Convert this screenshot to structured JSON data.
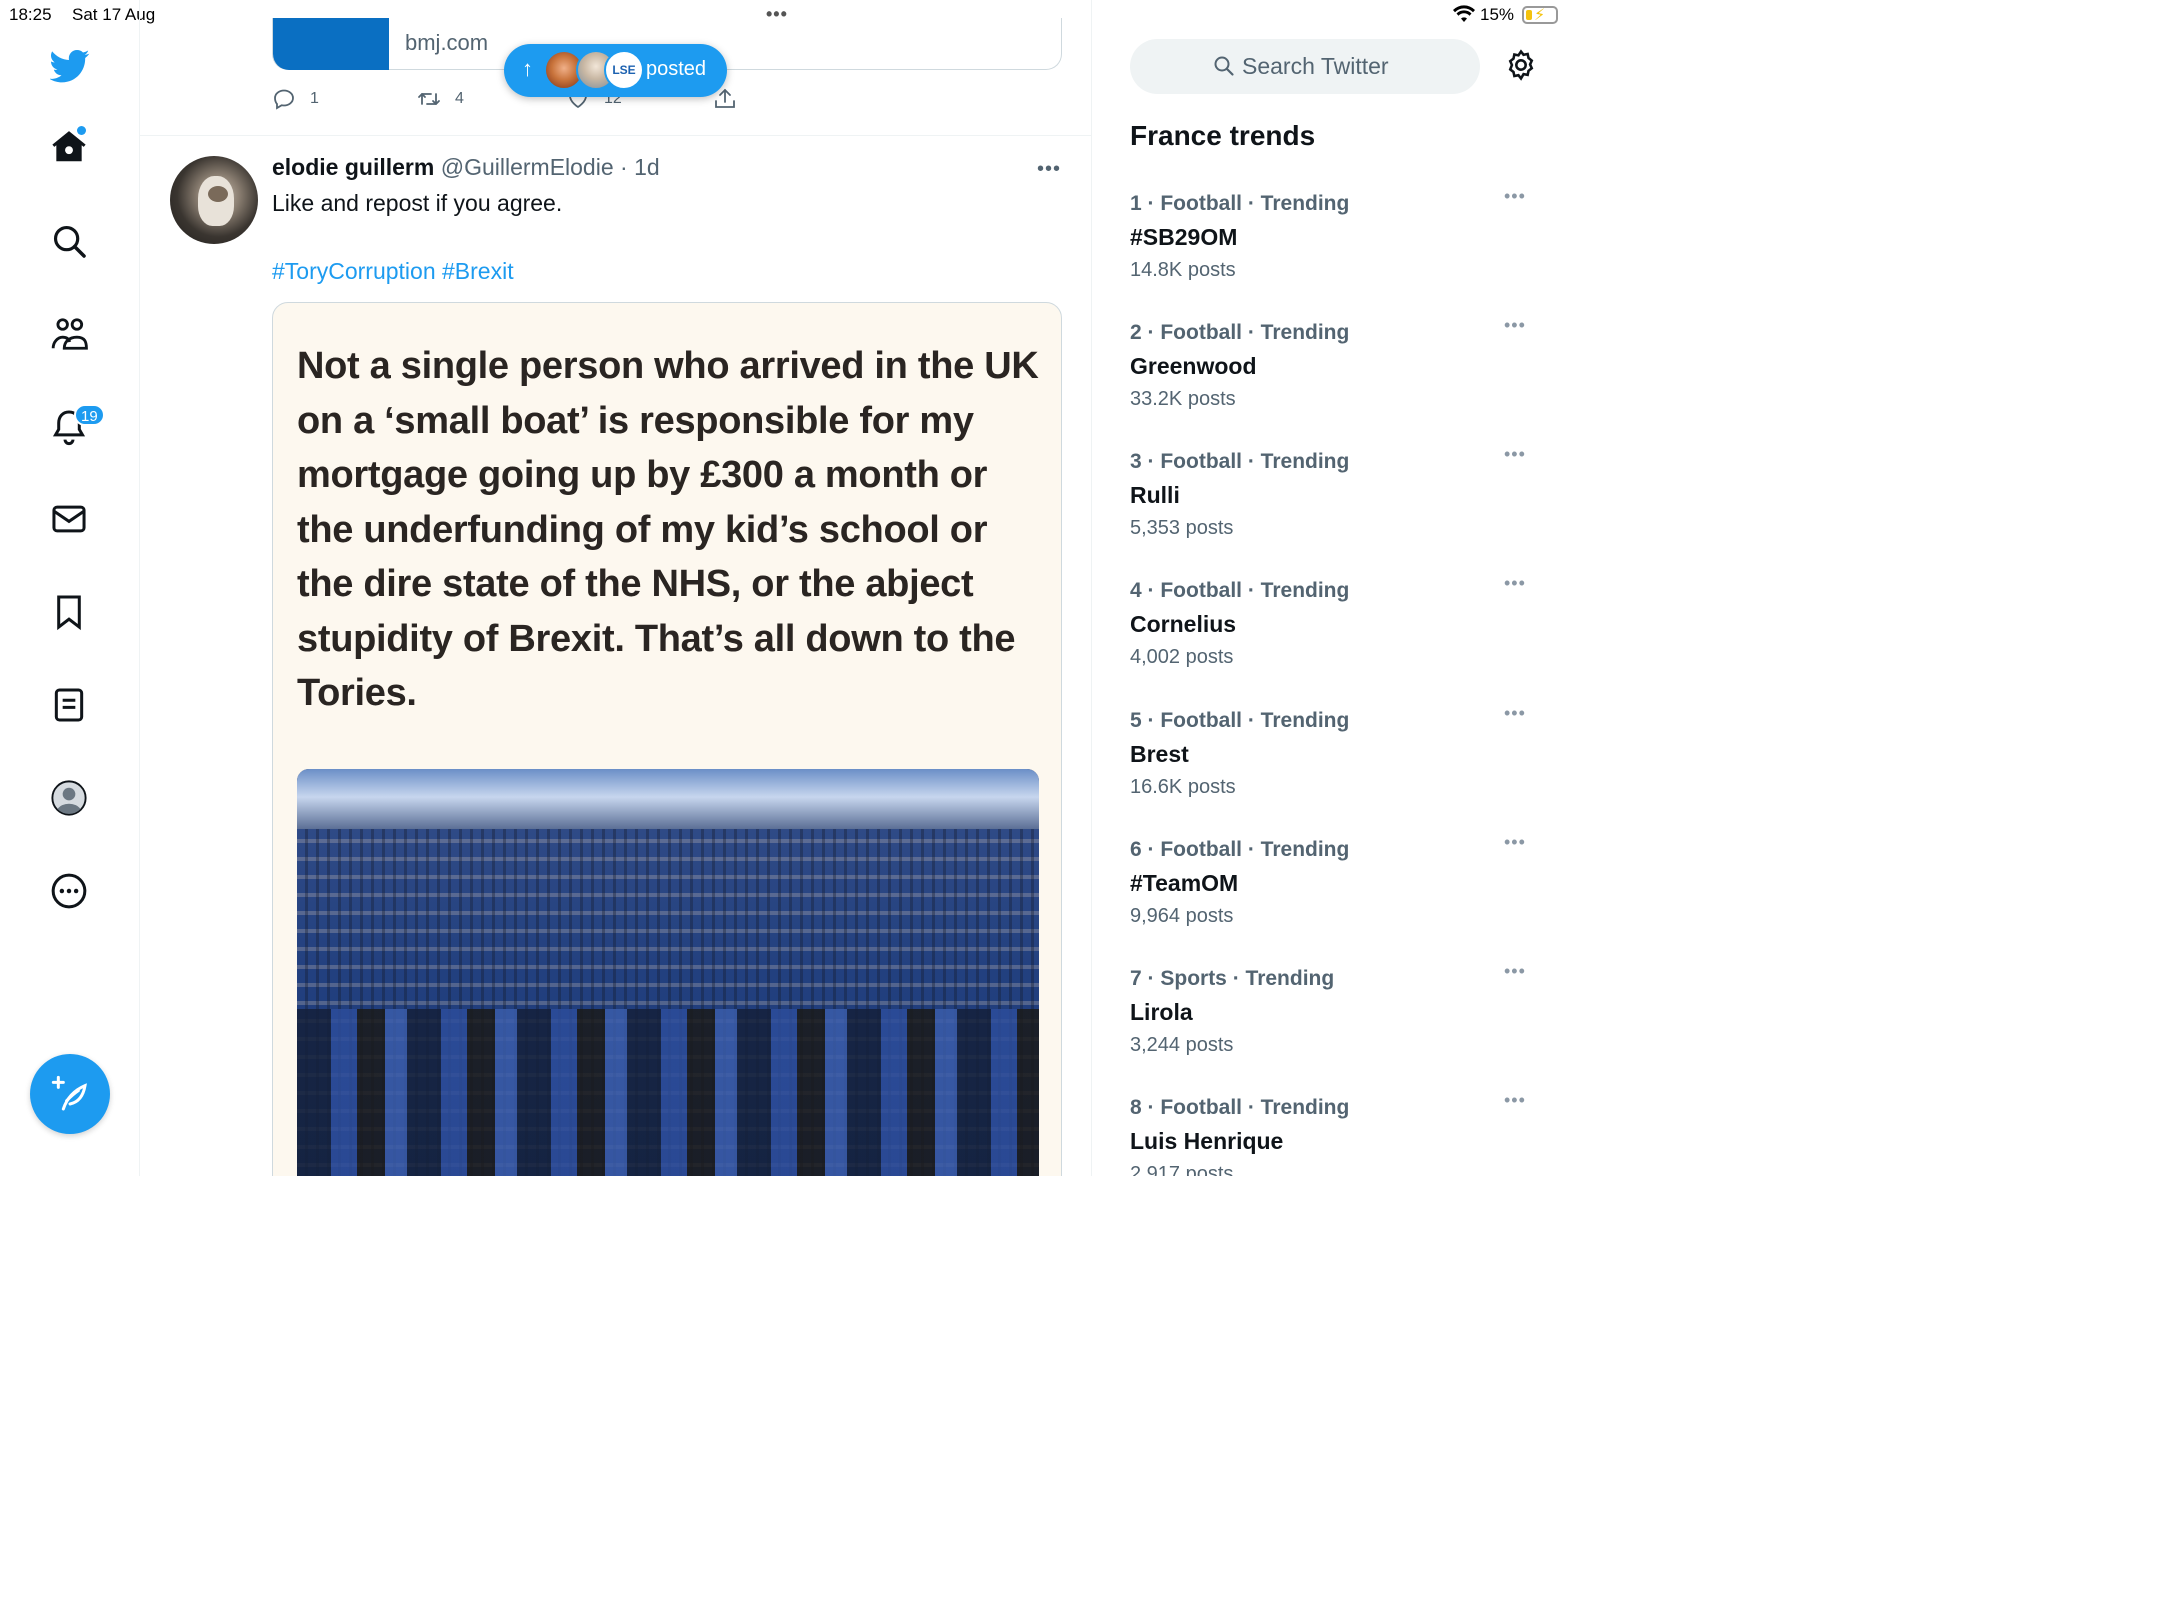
{
  "status_bar": {
    "time": "18:25",
    "date": "Sat 17 Aug",
    "battery": "15%"
  },
  "nav": {
    "notifications_badge": "19"
  },
  "previous_tweet": {
    "domain": "bmj.com",
    "replies": "1",
    "retweets": "4",
    "likes": "12"
  },
  "new_posts_pill": {
    "label": "posted"
  },
  "tweet": {
    "name": "elodie guillerm",
    "handle": "@GuillermElodie",
    "time": "· 1d",
    "text": "Like and repost if you agree.",
    "hashtags": "#ToryCorruption #Brexit",
    "image_quote": "Not a single person who arrived in the UK on a ‘small boat’ is responsible for my mortgage going up by £300 a month or the underfunding of my kid’s school or the dire state of the NHS, or the abject stupidity of Brexit. That’s all down to the Tories."
  },
  "sidebar": {
    "search_placeholder": "Search Twitter",
    "trends_title": "France trends",
    "trends": [
      {
        "rank": "1",
        "category": "Football · Trending",
        "name": "#SB29OM",
        "posts": "14.8K posts"
      },
      {
        "rank": "2",
        "category": "Football · Trending",
        "name": "Greenwood",
        "posts": "33.2K posts"
      },
      {
        "rank": "3",
        "category": "Football · Trending",
        "name": "Rulli",
        "posts": "5,353 posts"
      },
      {
        "rank": "4",
        "category": "Football · Trending",
        "name": "Cornelius",
        "posts": "4,002 posts"
      },
      {
        "rank": "5",
        "category": "Football · Trending",
        "name": "Brest",
        "posts": "16.6K posts"
      },
      {
        "rank": "6",
        "category": "Football · Trending",
        "name": "#TeamOM",
        "posts": "9,964 posts"
      },
      {
        "rank": "7",
        "category": "Sports · Trending",
        "name": "Lirola",
        "posts": "3,244 posts"
      },
      {
        "rank": "8",
        "category": "Football · Trending",
        "name": "Luis Henrique",
        "posts": "2,917 posts"
      }
    ]
  },
  "colors": {
    "accent": "#1d9bf0",
    "text": "#0f1419",
    "secondary": "#536471"
  }
}
